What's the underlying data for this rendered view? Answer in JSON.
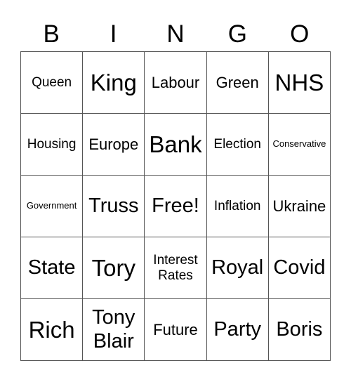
{
  "header": [
    "B",
    "I",
    "N",
    "G",
    "O"
  ],
  "cells": [
    {
      "text": "Queen",
      "size": "sm"
    },
    {
      "text": "King",
      "size": "xl"
    },
    {
      "text": "Labour",
      "size": "md"
    },
    {
      "text": "Green",
      "size": "md"
    },
    {
      "text": "NHS",
      "size": "xl"
    },
    {
      "text": "Housing",
      "size": "sm"
    },
    {
      "text": "Europe",
      "size": "md"
    },
    {
      "text": "Bank",
      "size": "xl"
    },
    {
      "text": "Election",
      "size": "sm"
    },
    {
      "text": "Conservative",
      "size": "xs"
    },
    {
      "text": "Government",
      "size": "xs"
    },
    {
      "text": "Truss",
      "size": "lg"
    },
    {
      "text": "Free!",
      "size": "lg"
    },
    {
      "text": "Inflation",
      "size": "sm"
    },
    {
      "text": "Ukraine",
      "size": "md"
    },
    {
      "text": "State",
      "size": "lg"
    },
    {
      "text": "Tory",
      "size": "xl"
    },
    {
      "text": "Interest Rates",
      "size": "sm"
    },
    {
      "text": "Royal",
      "size": "lg"
    },
    {
      "text": "Covid",
      "size": "lg"
    },
    {
      "text": "Rich",
      "size": "xl"
    },
    {
      "text": "Tony Blair",
      "size": "lg"
    },
    {
      "text": "Future",
      "size": "md"
    },
    {
      "text": "Party",
      "size": "lg"
    },
    {
      "text": "Boris",
      "size": "lg"
    }
  ]
}
